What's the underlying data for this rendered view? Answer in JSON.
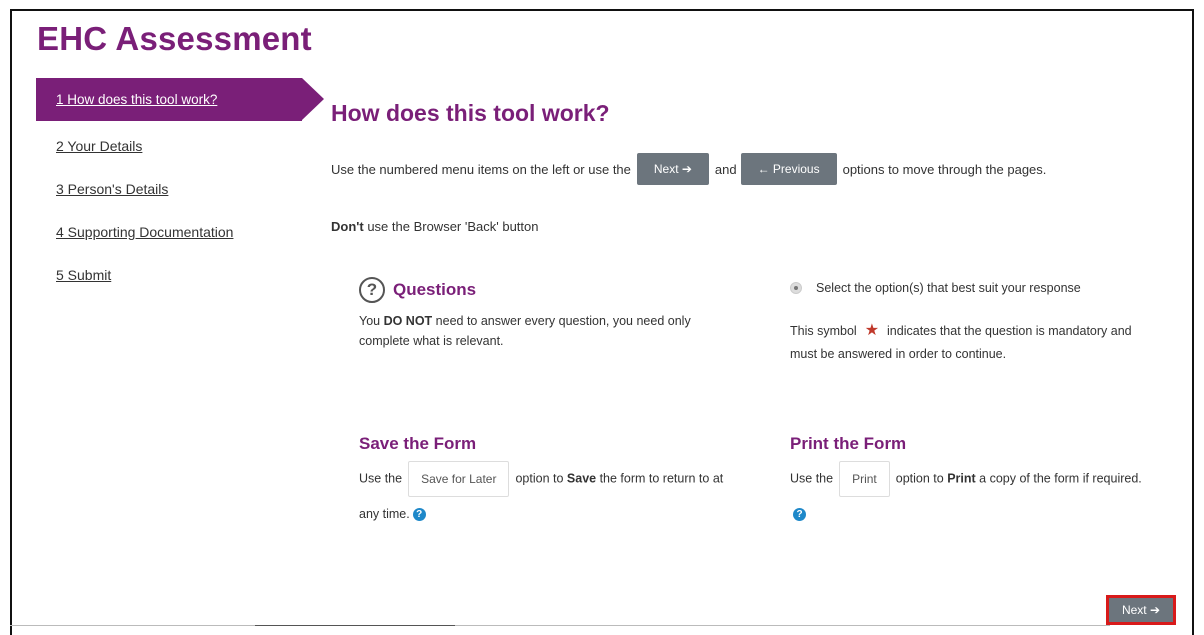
{
  "app": {
    "title": "EHC Assessment"
  },
  "sidebar": {
    "items": [
      {
        "label": "1 How does this tool work?"
      },
      {
        "label": "2 Your Details"
      },
      {
        "label": "3 Person's Details"
      },
      {
        "label": "4 Supporting Documentation"
      },
      {
        "label": "5 Submit"
      }
    ]
  },
  "main": {
    "title": "How does this tool work?",
    "intro": {
      "before": "Use the numbered menu items on the left or use the",
      "next_label": "Next ➔",
      "and": "and",
      "prev_label": "← Previous",
      "after": "options to move through the pages."
    },
    "warning": {
      "bold": "Don't",
      "rest": " use the Browser 'Back' button"
    },
    "questions": {
      "heading": "Questions",
      "text_before": "You ",
      "text_bold": "DO NOT",
      "text_after": " need to answer every question, you need only complete what is relevant."
    },
    "options": {
      "radio_text": "Select the option(s) that best suit your response",
      "symbol_before": "This symbol",
      "symbol_after": "indicates that the question is mandatory and must be answered in order to continue."
    },
    "save": {
      "heading": "Save the Form",
      "use_the": "Use the",
      "button": "Save for Later",
      "option_to": "option to ",
      "bold": "Save",
      "after": " the form to return to at any time."
    },
    "print": {
      "heading": "Print the Form",
      "use_the": "Use the",
      "button": "Print",
      "option_to": "option to ",
      "bold": "Print",
      "after": " a copy of the form if required."
    }
  },
  "footer": {
    "next_label": "Next ➔"
  },
  "colors": {
    "brand": "#7a1f78",
    "button": "#6c757d",
    "help": "#1e88c9",
    "highlight": "#d81a1a"
  }
}
